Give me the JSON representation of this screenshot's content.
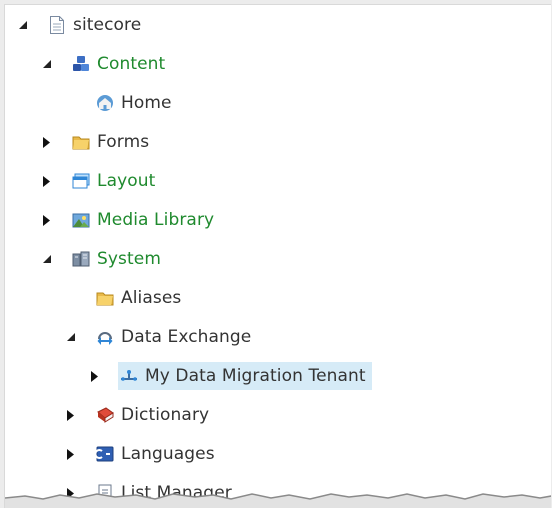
{
  "tree": {
    "nodes": [
      {
        "label": "sitecore",
        "icon": "document-icon",
        "expanded": true,
        "green": false
      },
      {
        "label": "Content",
        "icon": "content-cubes-icon",
        "expanded": true,
        "green": true
      },
      {
        "label": "Home",
        "icon": "home-globe-icon",
        "expanded": null,
        "green": false
      },
      {
        "label": "Forms",
        "icon": "folder-icon",
        "expanded": false,
        "green": false
      },
      {
        "label": "Layout",
        "icon": "layout-window-icon",
        "expanded": false,
        "green": true
      },
      {
        "label": "Media Library",
        "icon": "media-image-icon",
        "expanded": false,
        "green": true
      },
      {
        "label": "System",
        "icon": "system-servers-icon",
        "expanded": true,
        "green": true
      },
      {
        "label": "Aliases",
        "icon": "folder-icon",
        "expanded": null,
        "green": false
      },
      {
        "label": "Data Exchange",
        "icon": "data-exchange-icon",
        "expanded": true,
        "green": false
      },
      {
        "label": "My Data Migration Tenant",
        "icon": "tenant-network-icon",
        "expanded": false,
        "green": false,
        "selected": true
      },
      {
        "label": "Dictionary",
        "icon": "dictionary-book-icon",
        "expanded": false,
        "green": false
      },
      {
        "label": "Languages",
        "icon": "languages-flag-icon",
        "expanded": false,
        "green": false
      },
      {
        "label": "List Manager",
        "icon": "list-manager-icon",
        "expanded": false,
        "green": false
      }
    ]
  },
  "colors": {
    "green_label": "#1f8a2e",
    "default_label": "#333333",
    "selection": "#d6ebf7"
  }
}
